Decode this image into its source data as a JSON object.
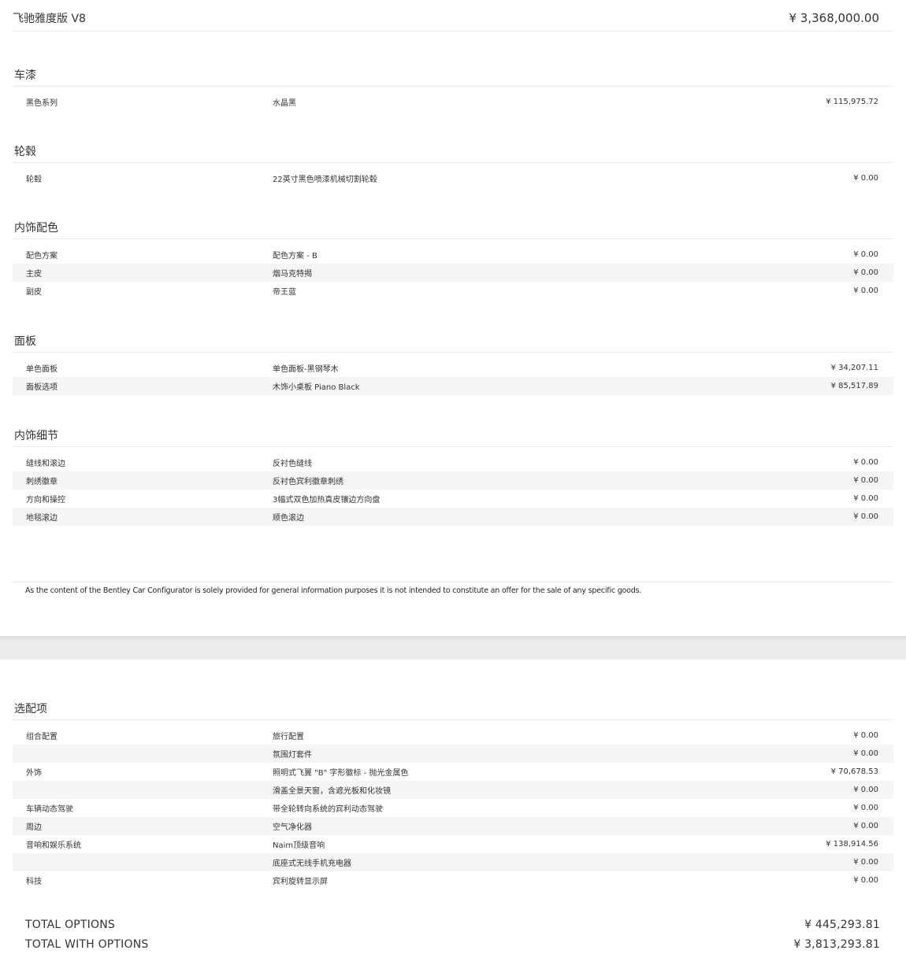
{
  "header": {
    "model": "飞驰雅度版 V8",
    "price": "¥ 3,368,000.00"
  },
  "sections": [
    {
      "title": "车漆",
      "rows": [
        {
          "category": "黑色系列",
          "option": "水晶黑",
          "price": "¥ 115,975.72"
        }
      ]
    },
    {
      "title": "轮毂",
      "rows": [
        {
          "category": "轮毂",
          "option": "22英寸黑色喷漆机械切割轮毂",
          "price": "¥ 0.00"
        }
      ]
    },
    {
      "title": "内饰配色",
      "rows": [
        {
          "category": "配色方案",
          "option": "配色方案 - B",
          "price": "¥ 0.00"
        },
        {
          "category": "主皮",
          "option": "烟马克特揭",
          "price": "¥ 0.00"
        },
        {
          "category": "副皮",
          "option": "帝王蓝",
          "price": "¥ 0.00"
        }
      ]
    },
    {
      "title": "面板",
      "rows": [
        {
          "category": "单色面板",
          "option": "单色面板-黑钢琴木",
          "price": "¥ 34,207.11"
        },
        {
          "category": "面板选项",
          "option": "木饰小桌板 Piano Black",
          "price": "¥ 85,517.89"
        }
      ]
    },
    {
      "title": "内饰细节",
      "rows": [
        {
          "category": "缝线和滚边",
          "option": "反衬色缝线",
          "price": "¥ 0.00"
        },
        {
          "category": "刺绣徽章",
          "option": "反衬色宾利徽章刺绣",
          "price": "¥ 0.00"
        },
        {
          "category": "方向和操控",
          "option": "3幅式双色加热真皮镶边方向盘",
          "price": "¥ 0.00"
        },
        {
          "category": "地毯滚边",
          "option": "顺色滚边",
          "price": "¥ 0.00"
        }
      ]
    },
    {
      "title": "选配项",
      "rows": [
        {
          "category": "组合配置",
          "option": "旅行配置",
          "price": "¥ 0.00"
        },
        {
          "category": "",
          "option": "氛围灯套件",
          "price": "¥ 0.00"
        },
        {
          "category": "外饰",
          "option": "照明式飞翼 \"B\" 字形徽标 - 抛光金属色",
          "price": "¥ 70,678.53"
        },
        {
          "category": "",
          "option": "滑盖全景天窗，含遮光板和化妆镜",
          "price": "¥ 0.00"
        },
        {
          "category": "车辆动态驾驶",
          "option": "带全轮转向系统的宾利动态驾驶",
          "price": "¥ 0.00"
        },
        {
          "category": "周边",
          "option": "空气净化器",
          "price": "¥ 0.00"
        },
        {
          "category": "音响和娱乐系统",
          "option": "Naim顶级音响",
          "price": "¥ 138,914.56"
        },
        {
          "category": "",
          "option": "底座式无线手机充电器",
          "price": "¥ 0.00"
        },
        {
          "category": "科技",
          "option": "宾利旋转显示屏",
          "price": "¥ 0.00"
        }
      ]
    }
  ],
  "disclaimer": "As the content of the Bentley Car Configurator is solely provided for general information purposes it is not intended to constitute an offer for the sale of any specific goods.",
  "totals": {
    "options_label": "TOTAL OPTIONS",
    "options_value": "¥ 445,293.81",
    "with_options_label": "TOTAL WITH OPTIONS",
    "with_options_value": "¥ 3,813,293.81"
  }
}
